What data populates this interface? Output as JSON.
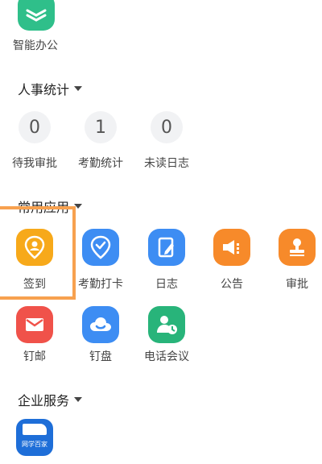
{
  "top_app": {
    "label": "智能办公",
    "color": "#2fbf8a"
  },
  "hr_stats": {
    "title": "人事统计",
    "items": [
      {
        "value": "0",
        "label": "待我审批"
      },
      {
        "value": "1",
        "label": "考勤统计"
      },
      {
        "value": "0",
        "label": "未读日志"
      }
    ]
  },
  "common_apps": {
    "title": "常用应用",
    "items": [
      {
        "label": "签到",
        "icon": "location-pin-icon",
        "color": "#f7a91a"
      },
      {
        "label": "考勤打卡",
        "icon": "check-pin-icon",
        "color": "#3d8df3"
      },
      {
        "label": "日志",
        "icon": "notebook-pen-icon",
        "color": "#3d8df3"
      },
      {
        "label": "公告",
        "icon": "megaphone-icon",
        "color": "#f78a2a"
      },
      {
        "label": "审批",
        "icon": "stamp-icon",
        "color": "#f78a2a"
      },
      {
        "label": "钉邮",
        "icon": "envelope-icon",
        "color": "#f0524a"
      },
      {
        "label": "钉盘",
        "icon": "cloud-drive-icon",
        "color": "#3d8df3"
      },
      {
        "label": "电话会议",
        "icon": "phone-meeting-icon",
        "color": "#28b47a"
      }
    ]
  },
  "enterprise": {
    "title": "企业服务",
    "app_icon_text": "网学百家"
  }
}
